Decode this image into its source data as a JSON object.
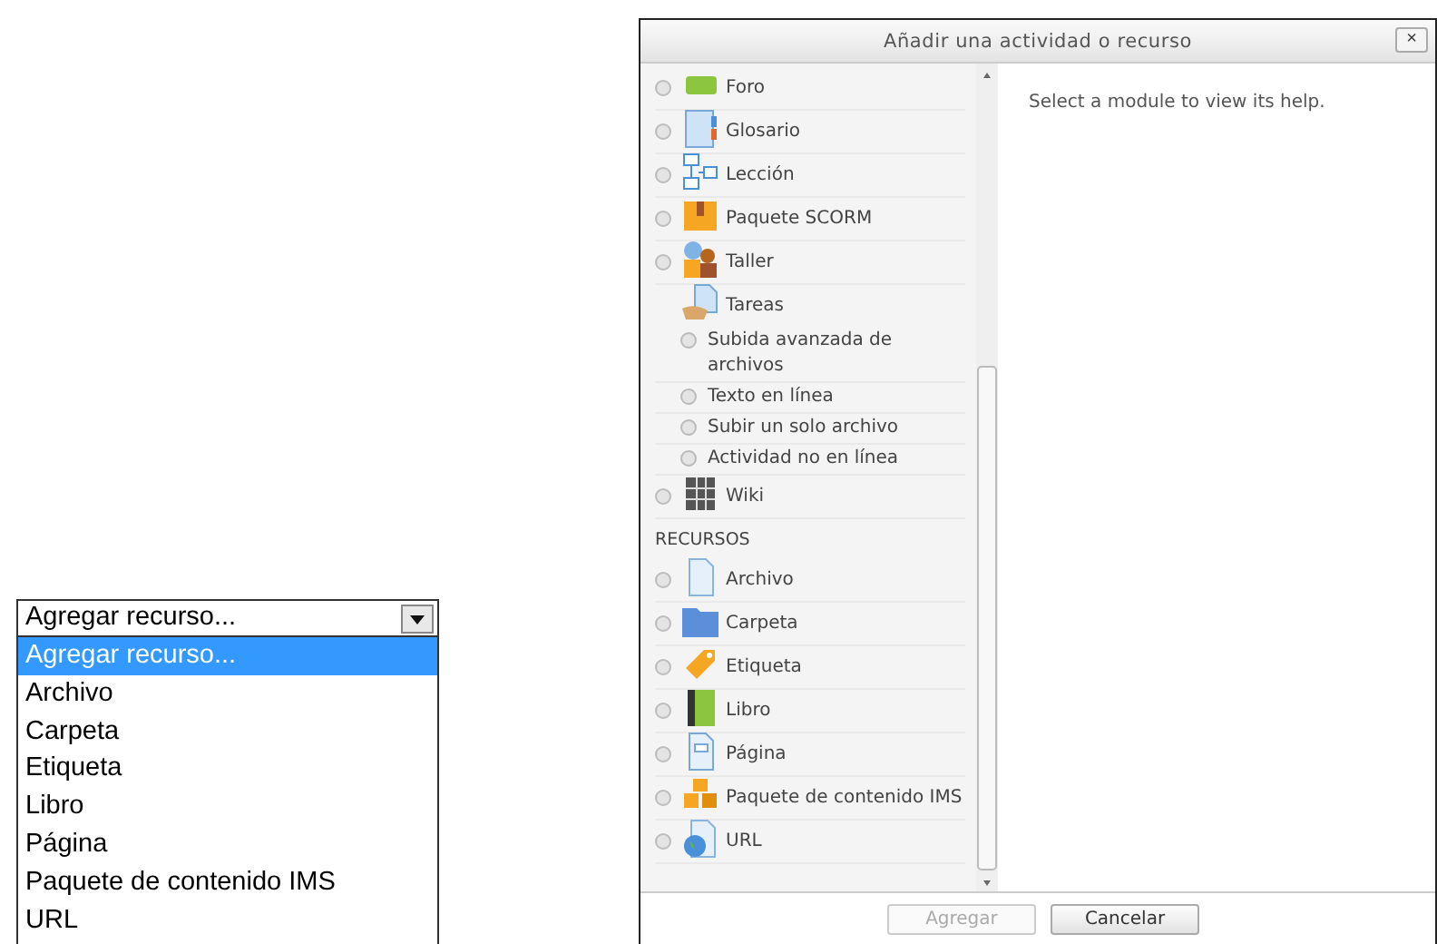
{
  "dropdown": {
    "value": "Agregar recurso...",
    "options": [
      {
        "label": "Agregar recurso...",
        "selected": true
      },
      {
        "label": "Archivo",
        "selected": false
      },
      {
        "label": "Carpeta",
        "selected": false
      },
      {
        "label": "Etiqueta",
        "selected": false
      },
      {
        "label": "Libro",
        "selected": false
      },
      {
        "label": "Página",
        "selected": false
      },
      {
        "label": "Paquete de contenido IMS",
        "selected": false
      },
      {
        "label": "URL",
        "selected": false
      }
    ]
  },
  "dialog": {
    "title": "Añadir una actividad o recurso",
    "close": "×",
    "modules": [
      {
        "kind": "module",
        "label": "Foro",
        "selected": false
      },
      {
        "kind": "module",
        "label": "Glosario",
        "selected": false
      },
      {
        "kind": "module",
        "label": "Lección",
        "selected": false
      },
      {
        "kind": "module",
        "label": "Paquete SCORM",
        "selected": false
      },
      {
        "kind": "module",
        "label": "Taller",
        "selected": false
      },
      {
        "kind": "group",
        "label": "Tareas",
        "children": [
          {
            "label": "Subida avanzada de archivos",
            "selected": false
          },
          {
            "label": "Texto en línea",
            "selected": false
          },
          {
            "label": "Subir un solo archivo",
            "selected": false
          },
          {
            "label": "Actividad no en línea",
            "selected": false
          }
        ]
      },
      {
        "kind": "module",
        "label": "Wiki",
        "selected": false
      },
      {
        "kind": "section",
        "label": "RECURSOS"
      },
      {
        "kind": "module",
        "label": "Archivo",
        "selected": false
      },
      {
        "kind": "module",
        "label": "Carpeta",
        "selected": false
      },
      {
        "kind": "module",
        "label": "Etiqueta",
        "selected": false
      },
      {
        "kind": "module",
        "label": "Libro",
        "selected": false
      },
      {
        "kind": "module",
        "label": "Página",
        "selected": false
      },
      {
        "kind": "module",
        "label": "Paquete de contenido IMS",
        "selected": false
      },
      {
        "kind": "module",
        "label": "URL",
        "selected": false
      }
    ],
    "help": "Select a module to view its help.",
    "buttons": [
      {
        "label": "Agregar",
        "disabled": true
      },
      {
        "label": "Cancelar",
        "disabled": false
      }
    ]
  }
}
